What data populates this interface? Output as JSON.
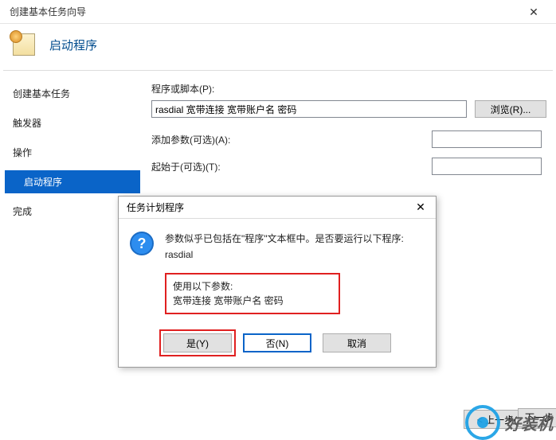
{
  "window": {
    "title": "创建基本任务向导",
    "close_glyph": "✕"
  },
  "header": {
    "page_title": "启动程序"
  },
  "sidebar": {
    "items": [
      {
        "label": "创建基本任务"
      },
      {
        "label": "触发器"
      },
      {
        "label": "操作"
      },
      {
        "label": "启动程序"
      },
      {
        "label": "完成"
      }
    ]
  },
  "main": {
    "program_label": "程序或脚本(P):",
    "program_value": "rasdial 宽带连接 宽带账户名 密码",
    "browse_label": "浏览(R)...",
    "args_label": "添加参数(可选)(A):",
    "startin_label": "起始于(可选)(T):"
  },
  "footer": {
    "back_label": "< 上一步(B)",
    "next_label": "下一步"
  },
  "dialog": {
    "title": "任务计划程序",
    "close_glyph": "✕",
    "icon_glyph": "?",
    "line1": "参数似乎已包括在\"程序\"文本框中。是否要运行以下程序:",
    "line2": "rasdial",
    "params_title": "使用以下参数:",
    "params_value": "宽带连接 宽带账户名 密码",
    "yes_label": "是(Y)",
    "no_label": "否(N)",
    "cancel_label": "取消"
  },
  "watermark": {
    "text": "好装机"
  }
}
